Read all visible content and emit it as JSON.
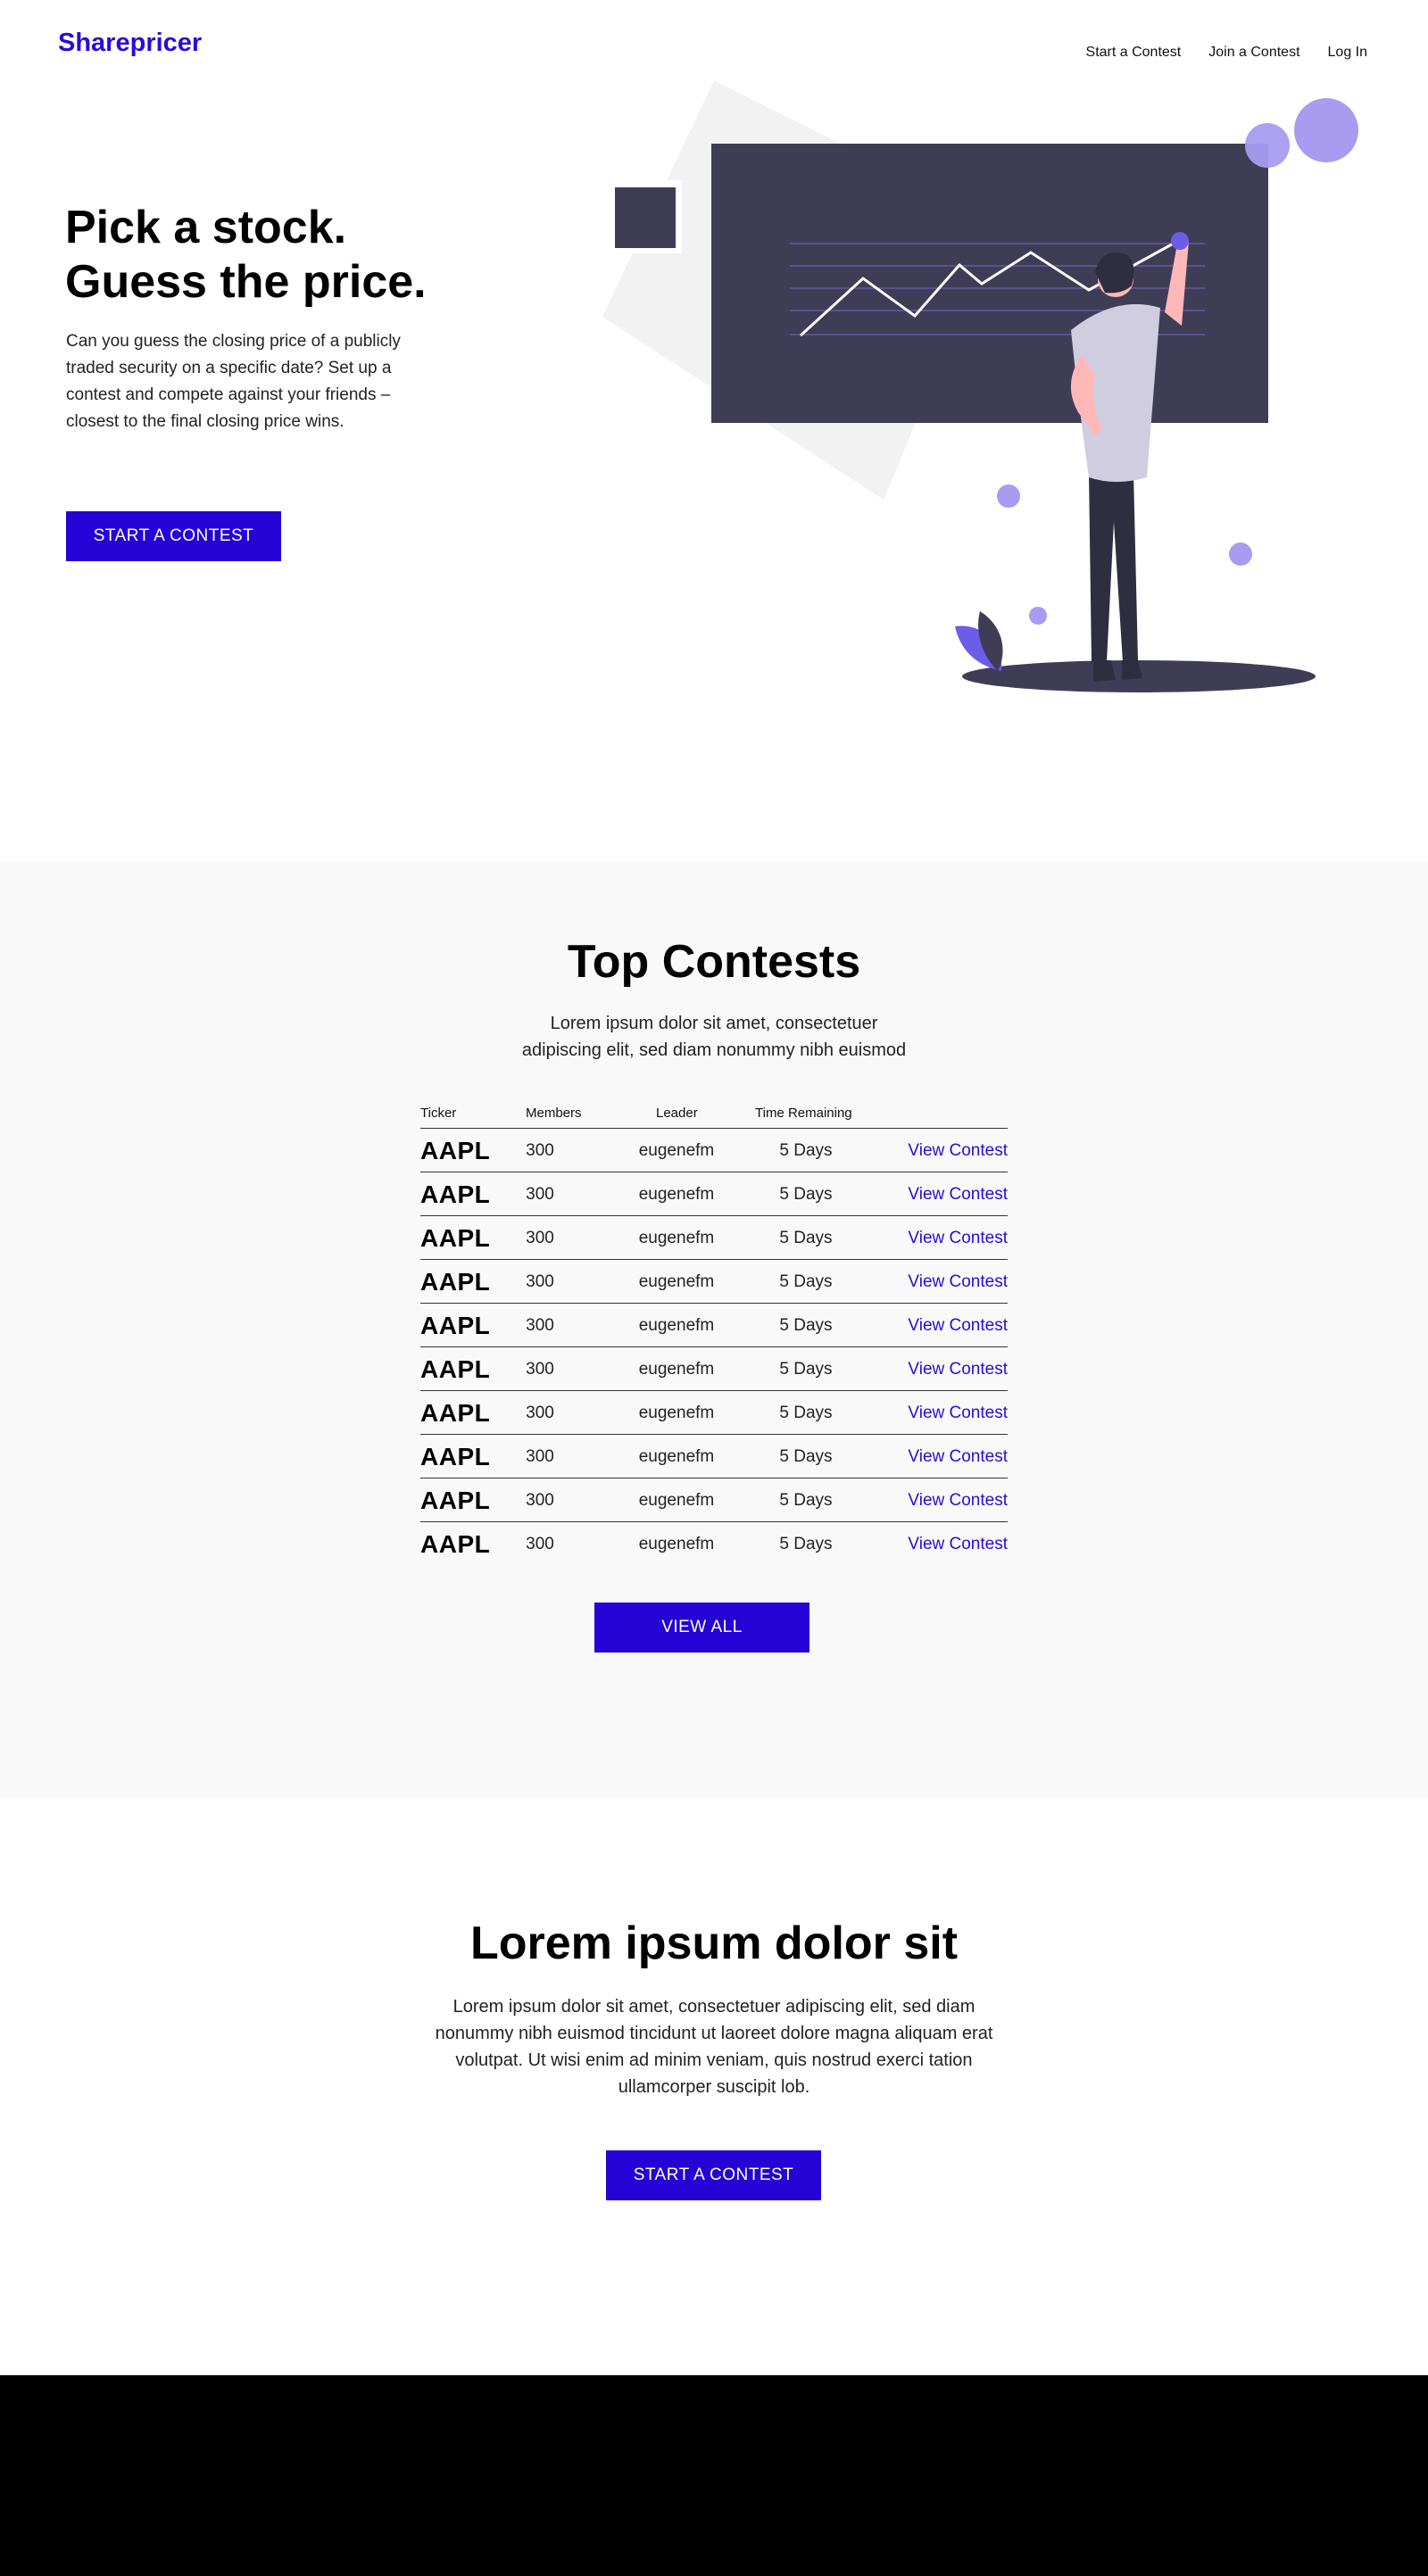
{
  "header": {
    "logo": "Sharepricer",
    "nav": [
      "Start a Contest",
      "Join a Contest",
      "Log In"
    ]
  },
  "hero": {
    "title_line1": "Pick a stock.",
    "title_line2": "Guess the price.",
    "description": "Can you guess the closing price of a publicly traded security on a specific date? Set up a contest and compete against your friends – closest to the final closing price wins.",
    "cta": "START A CONTEST"
  },
  "colors": {
    "accent": "#2503d6",
    "board": "#3f3d56",
    "purple_light": "#a89bf0"
  },
  "contests": {
    "title": "Top Contests",
    "subtitle": "Lorem ipsum dolor sit amet, consectetuer adipiscing elit, sed diam nonummy nibh euismod",
    "columns": [
      "Ticker",
      "Members",
      "Leader",
      "Time Remaining"
    ],
    "rows": [
      {
        "ticker": "AAPL",
        "members": "300",
        "leader": "eugenefm",
        "remaining": "5 Days",
        "action": "View Contest"
      },
      {
        "ticker": "AAPL",
        "members": "300",
        "leader": "eugenefm",
        "remaining": "5 Days",
        "action": "View Contest"
      },
      {
        "ticker": "AAPL",
        "members": "300",
        "leader": "eugenefm",
        "remaining": "5 Days",
        "action": "View Contest"
      },
      {
        "ticker": "AAPL",
        "members": "300",
        "leader": "eugenefm",
        "remaining": "5 Days",
        "action": "View Contest"
      },
      {
        "ticker": "AAPL",
        "members": "300",
        "leader": "eugenefm",
        "remaining": "5 Days",
        "action": "View Contest"
      },
      {
        "ticker": "AAPL",
        "members": "300",
        "leader": "eugenefm",
        "remaining": "5 Days",
        "action": "View Contest"
      },
      {
        "ticker": "AAPL",
        "members": "300",
        "leader": "eugenefm",
        "remaining": "5 Days",
        "action": "View Contest"
      },
      {
        "ticker": "AAPL",
        "members": "300",
        "leader": "eugenefm",
        "remaining": "5 Days",
        "action": "View Contest"
      },
      {
        "ticker": "AAPL",
        "members": "300",
        "leader": "eugenefm",
        "remaining": "5 Days",
        "action": "View Contest"
      },
      {
        "ticker": "AAPL",
        "members": "300",
        "leader": "eugenefm",
        "remaining": "5 Days",
        "action": "View Contest"
      }
    ],
    "view_all": "VIEW ALL"
  },
  "lorem": {
    "title": "Lorem ipsum dolor sit",
    "text": "Lorem ipsum dolor sit amet, consectetuer adipiscing elit, sed diam nonummy nibh euismod tincidunt ut laoreet dolore magna aliquam erat volutpat. Ut wisi enim ad minim veniam, quis nostrud exerci tation ullamcorper suscipit lob.",
    "cta": "START A CONTEST"
  }
}
